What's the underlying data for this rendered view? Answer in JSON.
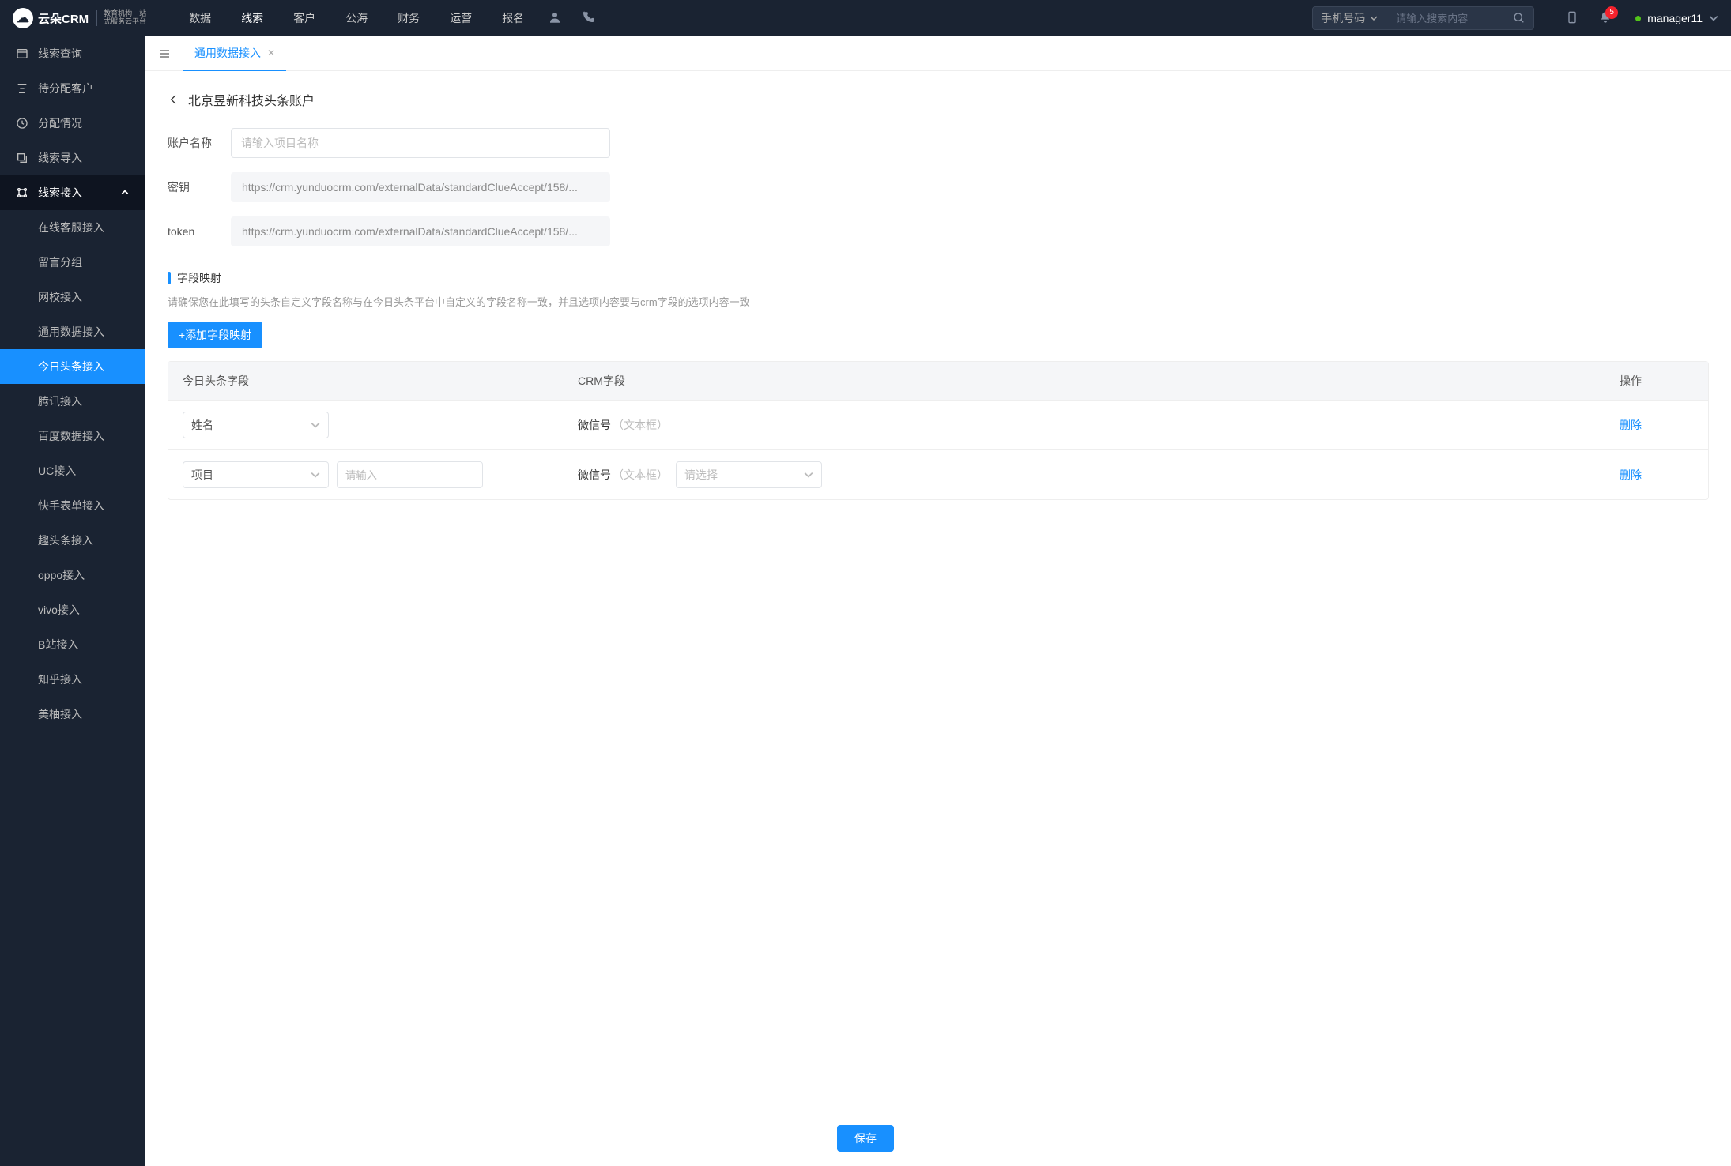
{
  "header": {
    "brand_name": "云朵CRM",
    "brand_sub1": "教育机构一站",
    "brand_sub2": "式服务云平台",
    "nav": [
      "数据",
      "线索",
      "客户",
      "公海",
      "财务",
      "运营",
      "报名"
    ],
    "nav_active": "线索",
    "search_type": "手机号码",
    "search_placeholder": "请输入搜索内容",
    "badge": "5",
    "user": "manager11"
  },
  "sidebar": {
    "items": [
      {
        "label": "线索查询"
      },
      {
        "label": "待分配客户"
      },
      {
        "label": "分配情况"
      },
      {
        "label": "线索导入"
      },
      {
        "label": "线索接入",
        "expanded": true,
        "children": [
          "在线客服接入",
          "留言分组",
          "网校接入",
          "通用数据接入",
          "今日头条接入",
          "腾讯接入",
          "百度数据接入",
          "UC接入",
          "快手表单接入",
          "趣头条接入",
          "oppo接入",
          "vivo接入",
          "B站接入",
          "知乎接入",
          "美柚接入"
        ],
        "active_child": "今日头条接入"
      }
    ]
  },
  "tabs": {
    "items": [
      {
        "label": "通用数据接入",
        "active": true
      }
    ]
  },
  "page": {
    "title": "北京昱新科技头条账户",
    "form": {
      "account_label": "账户名称",
      "account_placeholder": "请输入项目名称",
      "secret_label": "密钥",
      "secret_value": "https://crm.yunduocrm.com/externalData/standardClueAccept/158/...",
      "token_label": "token",
      "token_value": "https://crm.yunduocrm.com/externalData/standardClueAccept/158/..."
    },
    "section": {
      "title": "字段映射",
      "hint": "请确保您在此填写的头条自定义字段名称与在今日头条平台中自定义的字段名称一致，并且选项内容要与crm字段的选项内容一致",
      "add_btn": "+添加字段映射"
    },
    "table": {
      "col1": "今日头条字段",
      "col2": "CRM字段",
      "col3": "操作",
      "rows": [
        {
          "src_select": "姓名",
          "src_input": null,
          "crm_name": "微信号",
          "crm_type": "（文本框）",
          "crm_select": null,
          "delete": "删除"
        },
        {
          "src_select": "项目",
          "src_input_placeholder": "请输入",
          "crm_name": "微信号",
          "crm_type": "（文本框）",
          "crm_select_placeholder": "请选择",
          "delete": "删除"
        }
      ]
    },
    "save": "保存"
  }
}
